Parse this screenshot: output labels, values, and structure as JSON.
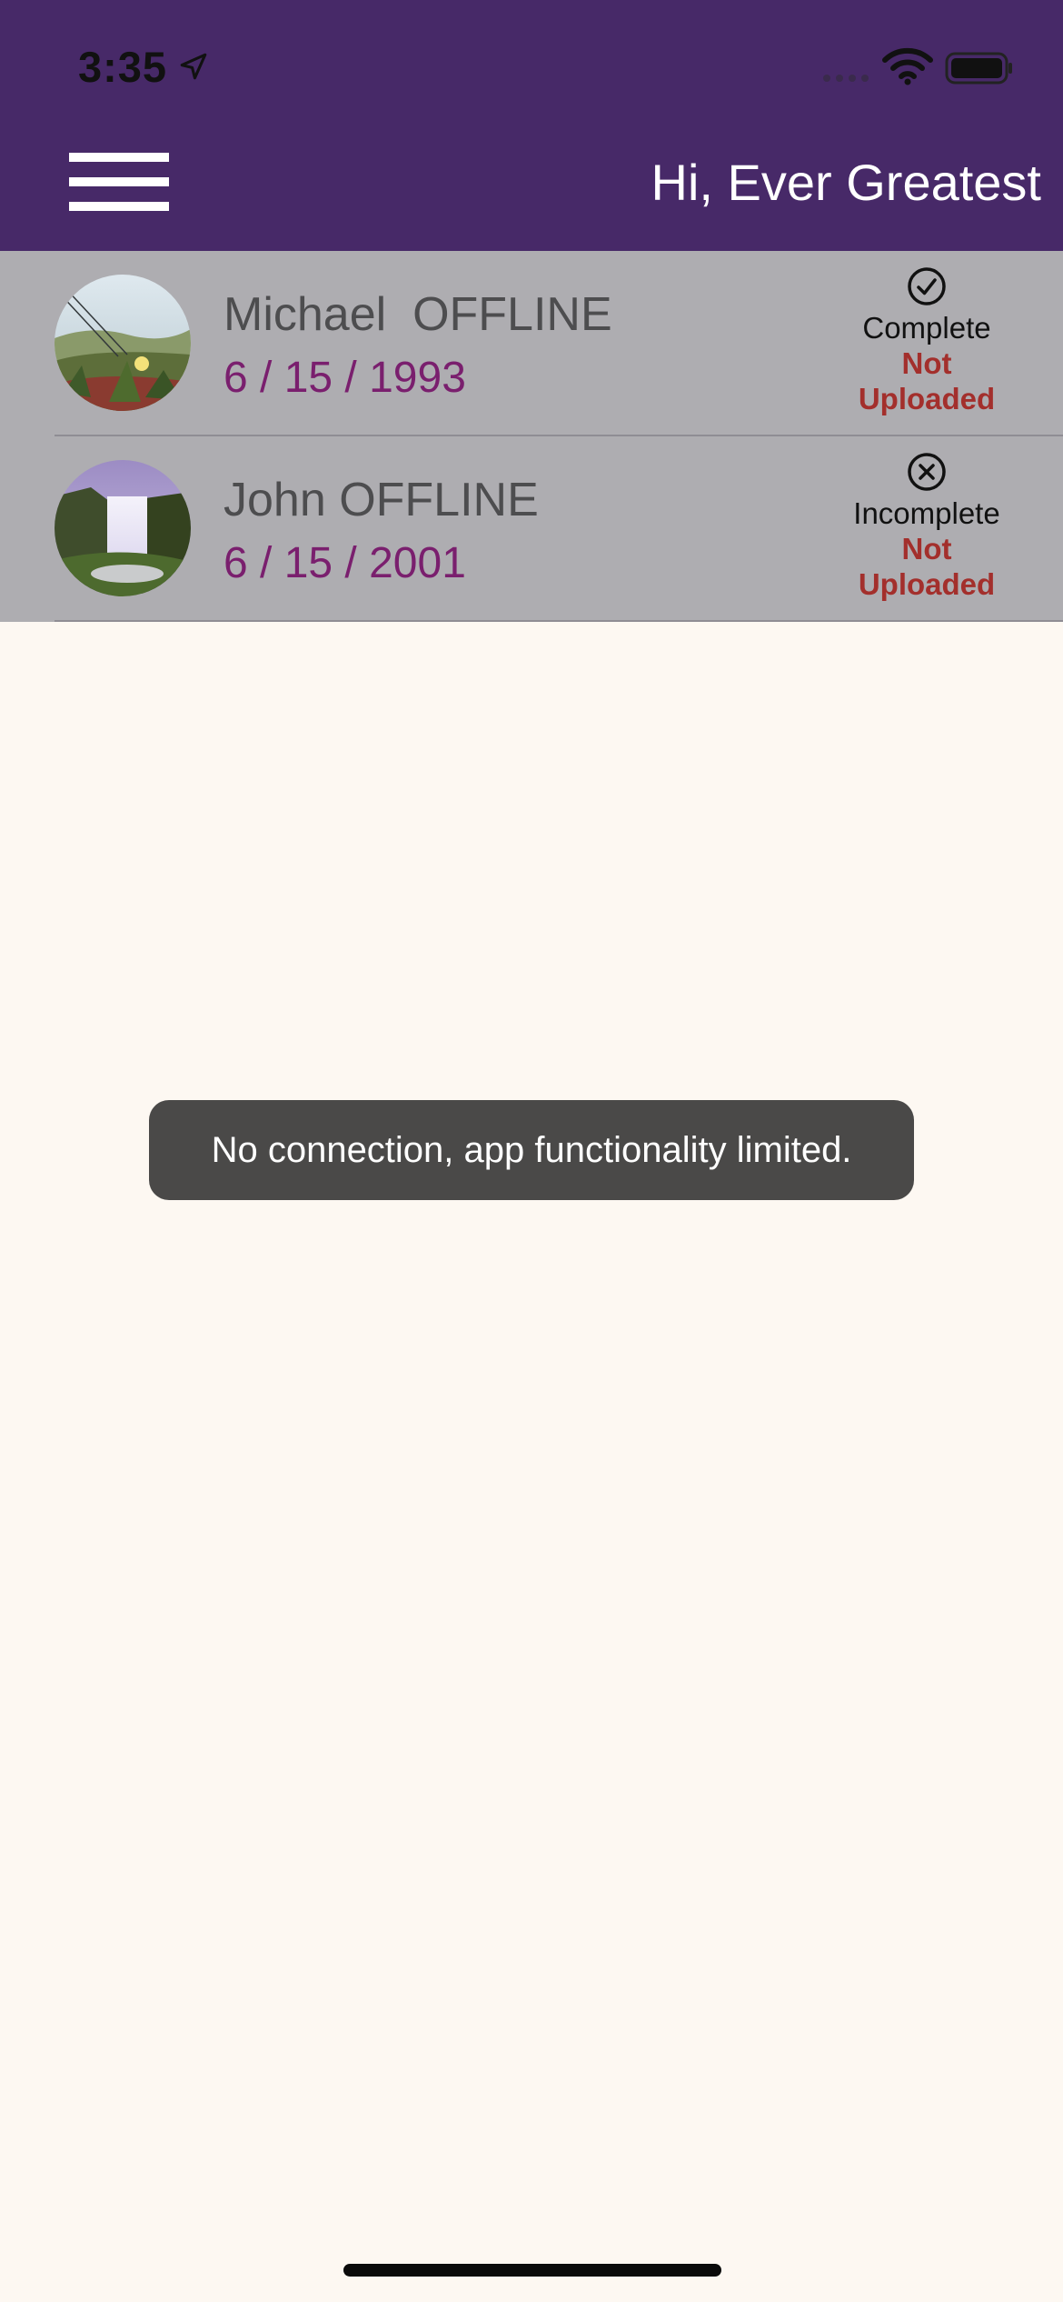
{
  "status_bar": {
    "time": "3:35"
  },
  "header": {
    "greeting": "Hi, Ever Greatest",
    "menu_icon": "hamburger-menu-icon"
  },
  "list": {
    "items": [
      {
        "name": "Michael  OFFLINE",
        "date": "6 / 15 / 1993",
        "status": "Complete",
        "status_icon": "check-circle-icon",
        "upload_status": "Not Uploaded",
        "upload_line1": "Not",
        "upload_line2": "Uploaded",
        "avatar": "meadow-flower-photo"
      },
      {
        "name": "John OFFLINE",
        "date": "6 / 15 / 2001",
        "status": "Incomplete",
        "status_icon": "x-circle-icon",
        "upload_status": "Not Uploaded",
        "upload_line1": "Not",
        "upload_line2": "Uploaded",
        "avatar": "waterfall-photo"
      }
    ]
  },
  "toast": {
    "message": "No connection, app functionality limited."
  },
  "colors": {
    "header_bg": "#472968",
    "list_bg": "#aeadb1",
    "page_bg": "#fdf8f2",
    "date_color": "#7a1f6e",
    "not_uploaded_color": "#a32f2c",
    "toast_bg": "#4a4948"
  }
}
